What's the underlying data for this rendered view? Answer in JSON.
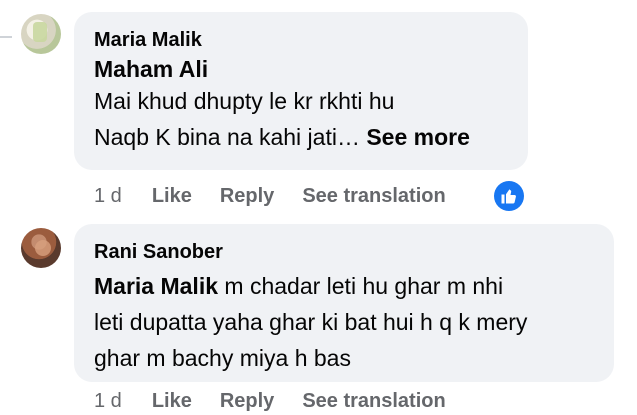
{
  "comments": [
    {
      "author": "Maria Malik",
      "tagged": "Maham Ali",
      "line1": "Mai khud dhupty le kr rkhti hu",
      "line2": "Naqb K bina na kahi jati…",
      "see_more": "See more",
      "time": "1 d",
      "like": "Like",
      "reply": "Reply",
      "translate": "See translation",
      "reaction": "like"
    },
    {
      "author": "Rani Sanober",
      "tagged": "Maria Malik",
      "line1": " m chadar leti hu ghar m nhi",
      "line2": "leti dupatta yaha ghar ki bat hui h q k mery",
      "line3": "ghar m bachy miya h bas",
      "time": "1 d",
      "like": "Like",
      "reply": "Reply",
      "translate": "See translation"
    }
  ],
  "colors": {
    "bubble": "#f0f2f5",
    "meta": "#65676b",
    "accent": "#1877f2"
  }
}
